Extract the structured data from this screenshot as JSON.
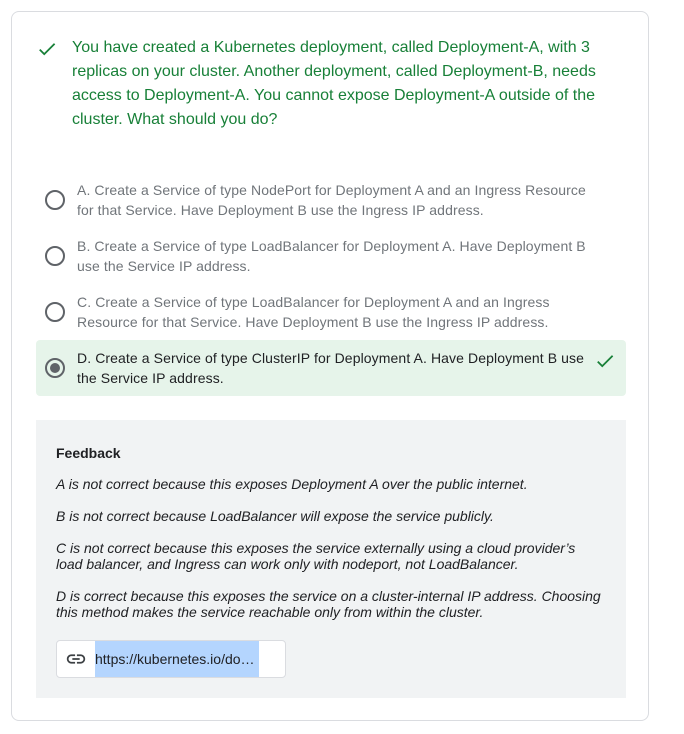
{
  "question": {
    "status_icon": "check-icon",
    "text": "You have created a Kubernetes deployment, called Deployment-A, with 3 replicas on your cluster. Another deployment, called Deployment-B, needs access to Deployment-A. You cannot expose Deployment-A outside of the cluster. What should you do?"
  },
  "options": [
    {
      "text": "A. Create a Service of type NodePort for Deployment A and an Ingress Resource for that Service. Have Deployment B use the Ingress IP address.",
      "selected": false
    },
    {
      "text": "B. Create a Service of type LoadBalancer for Deployment A. Have Deployment B use the Service IP address.",
      "selected": false
    },
    {
      "text": "C. Create a Service of type LoadBalancer for Deployment A and an Ingress Resource for that Service. Have Deployment B use the Ingress IP address.",
      "selected": false
    },
    {
      "text": "D. Create a Service of type ClusterIP for Deployment A. Have Deployment B use the Service IP address.",
      "selected": true,
      "correct": true
    }
  ],
  "feedback": {
    "title": "Feedback",
    "lines": [
      "A is not correct because this exposes Deployment A over the public internet.",
      "B is not correct because LoadBalancer will expose the service publicly.",
      "C is not correct because this exposes the service externally using a cloud provider’s load balancer, and Ingress can work only with nodeport, not LoadBalancer.",
      "D is correct because this exposes the service on a cluster-internal IP address. Choosing this method makes the service reachable only from within the cluster."
    ],
    "link_text": "https://kubernetes.io/docs/concepts/services-networking/service/"
  },
  "colors": {
    "correct_green": "#188038",
    "selected_bg": "#e6f4ea",
    "feedback_bg": "#f1f3f4",
    "link_highlight": "#b4d5fe"
  }
}
